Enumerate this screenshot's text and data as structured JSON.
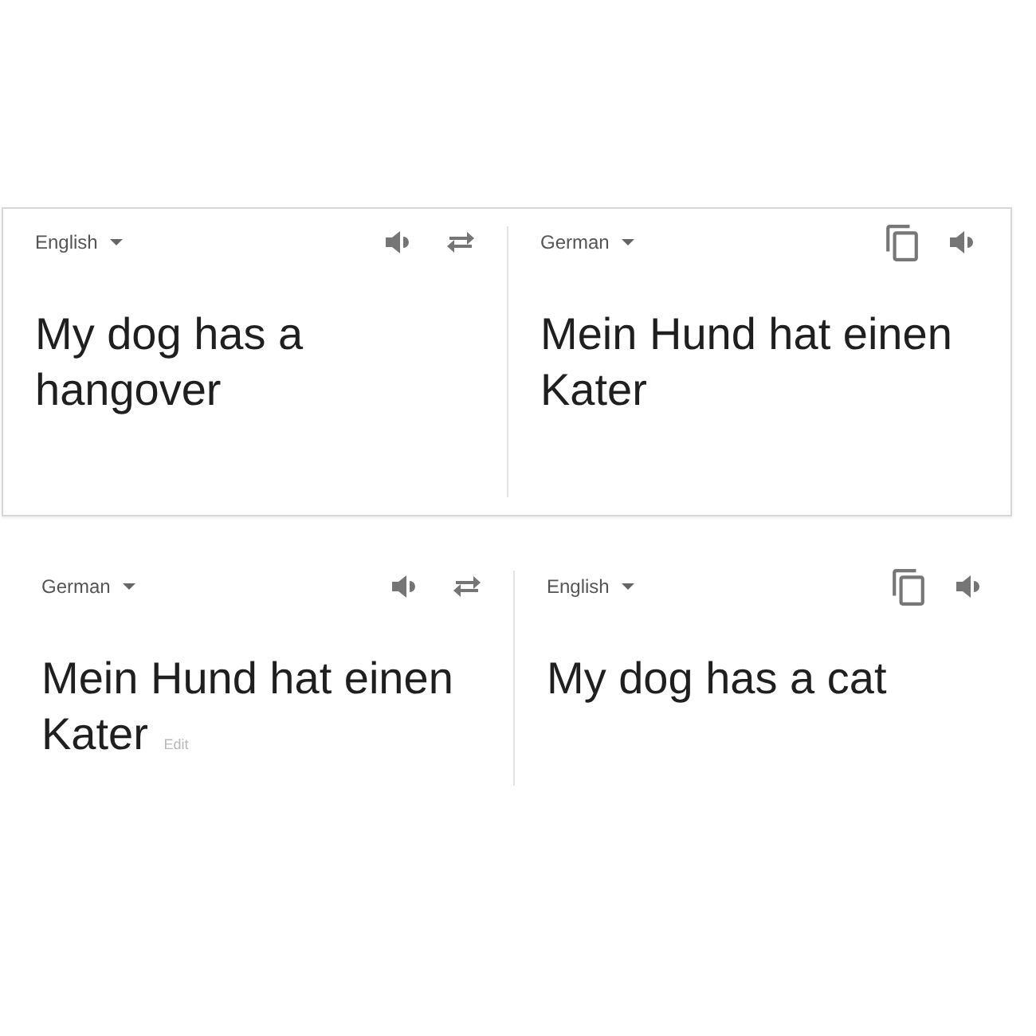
{
  "translations": [
    {
      "bordered": true,
      "source": {
        "language": "English",
        "text": "My dog has a hangover"
      },
      "target": {
        "language": "German",
        "text": "Mein Hund hat einen Kater"
      }
    },
    {
      "bordered": false,
      "source": {
        "language": "German",
        "text": "Mein Hund hat einen Kater",
        "edit_link": "Edit"
      },
      "target": {
        "language": "English",
        "text": "My dog has a cat"
      }
    }
  ]
}
